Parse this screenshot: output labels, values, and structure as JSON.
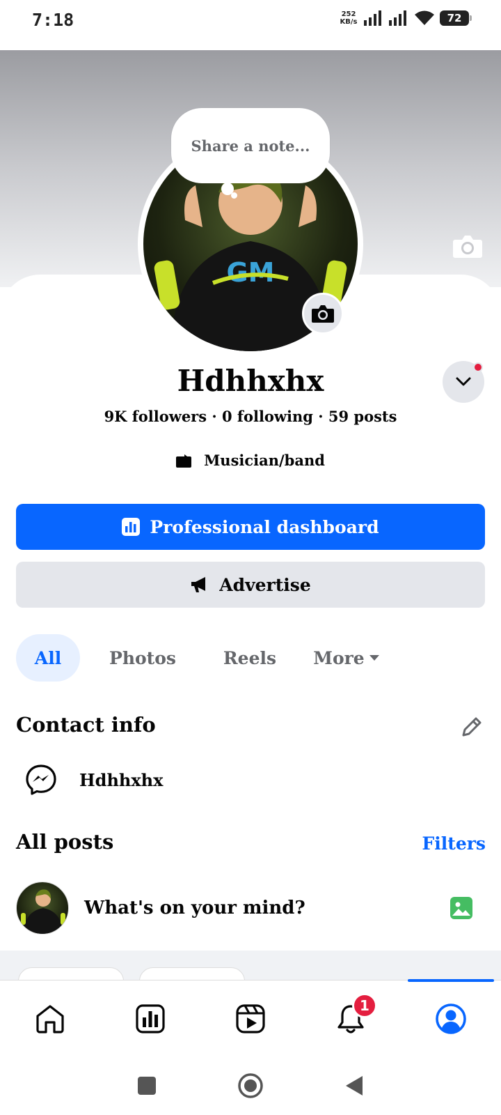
{
  "status_bar": {
    "time": "7:18",
    "net_speed_value": "252",
    "net_speed_unit": "KB/s",
    "battery": "72"
  },
  "note": {
    "text": "Share a note..."
  },
  "profile": {
    "name": "Hdhhxhx",
    "stats": "9K followers · 0 following · 59 posts",
    "category": "Musician/band"
  },
  "buttons": {
    "dashboard": "Professional dashboard",
    "advertise": "Advertise"
  },
  "tabs": [
    {
      "label": "All",
      "active": true
    },
    {
      "label": "Photos"
    },
    {
      "label": "Reels"
    },
    {
      "label": "More"
    }
  ],
  "contact": {
    "title": "Contact info",
    "messenger_name": "Hdhhxhx"
  },
  "posts": {
    "title": "All posts",
    "filters": "Filters",
    "composer_placeholder": "What's on your mind?"
  },
  "bottom_nav": {
    "items": [
      {
        "icon": "home-icon"
      },
      {
        "icon": "dashboard-icon"
      },
      {
        "icon": "reels-icon"
      },
      {
        "icon": "bell-icon",
        "badge": "1"
      },
      {
        "icon": "profile-icon",
        "active": true
      }
    ]
  },
  "colors": {
    "accent": "#0866ff",
    "badge": "#e41e3f",
    "secondary_bg": "#e4e6eb"
  }
}
